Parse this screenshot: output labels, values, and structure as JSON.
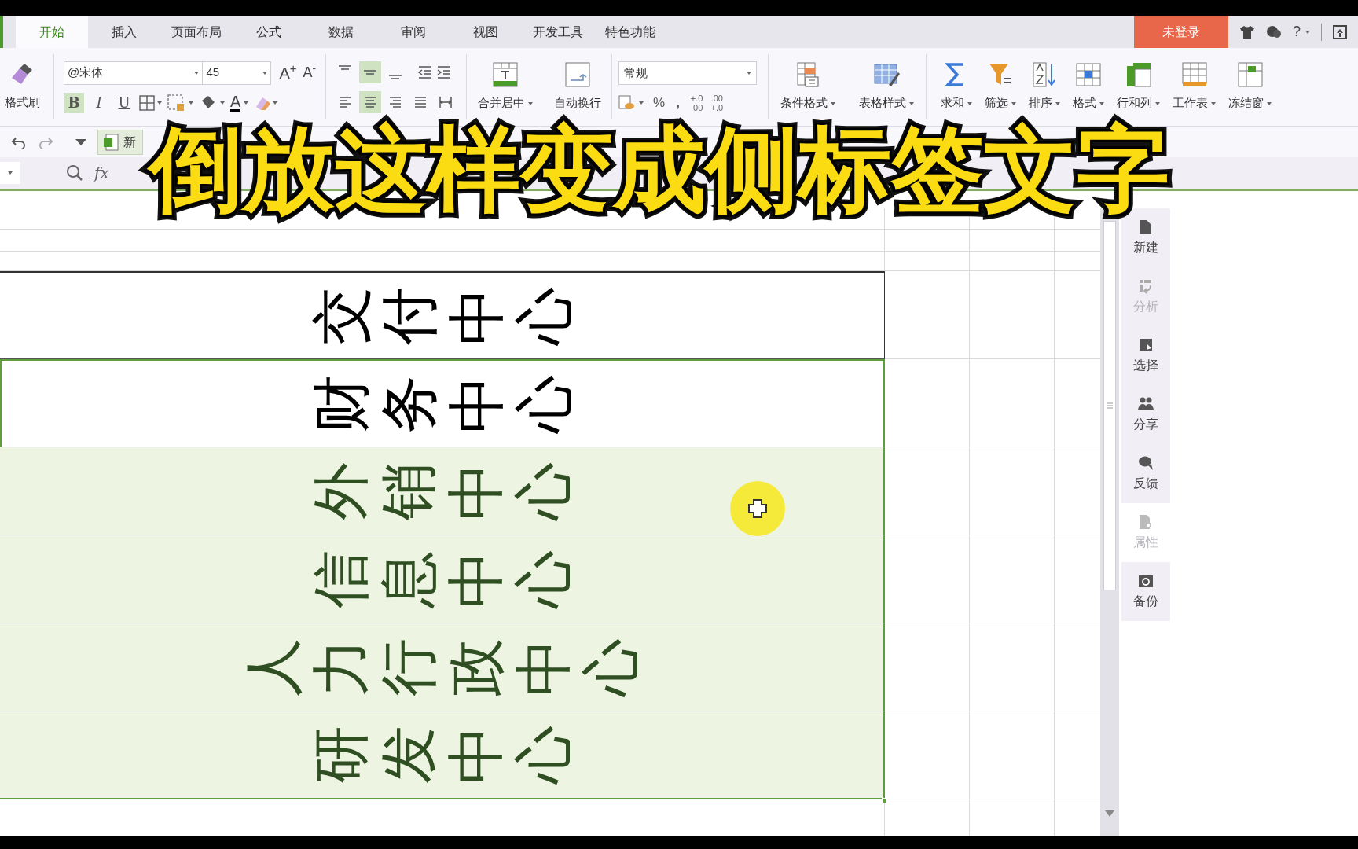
{
  "tabs": [
    {
      "label": "开始",
      "selected": true
    },
    {
      "label": "插入",
      "selected": false
    },
    {
      "label": "页面布局",
      "selected": false
    },
    {
      "label": "公式",
      "selected": false
    },
    {
      "label": "数据",
      "selected": false
    },
    {
      "label": "审阅",
      "selected": false
    },
    {
      "label": "视图",
      "selected": false
    },
    {
      "label": "开发工具",
      "selected": false
    },
    {
      "label": "特色功能",
      "selected": false
    }
  ],
  "account": {
    "login": "未登录",
    "help": "?"
  },
  "ribbon": {
    "format_painter": "格式刷",
    "font_family": "@宋体",
    "font_size": "45",
    "grow_font": "A$^{+}$",
    "shrink_font": "A$^{-}$",
    "styles": [
      {
        "label": "B",
        "on": true
      },
      {
        "label": "I",
        "on": false
      },
      {
        "label": "U",
        "on": false
      }
    ],
    "font_color": "A",
    "vertical_align": [
      {
        "selected": false
      },
      {
        "selected": true
      },
      {
        "selected": false
      }
    ],
    "horizontal_align": [
      {
        "selected": false
      },
      {
        "selected": true
      },
      {
        "selected": false
      },
      {
        "selected": false
      },
      {
        "selected": false
      }
    ],
    "merge": "合并居中",
    "wrap": "自动换行",
    "number_format": "常规",
    "percent": "%",
    "comma": ",",
    "decimals": [
      [
        "+.0",
        ".00"
      ],
      [
        ".00",
        "+.0"
      ]
    ],
    "style_buttons": [
      "条件格式",
      "表格样式"
    ],
    "cell_buttons": [
      "求和",
      "筛选",
      "排序",
      "格式",
      "行和列",
      "工作表",
      "冻结窗"
    ]
  },
  "quick_access": {
    "document_tab": "新"
  },
  "formula_bar": {
    "fx": "fx"
  },
  "sheet": {
    "rows": [
      {
        "text": "交付中心",
        "selected": false,
        "active": false
      },
      {
        "text": "财务中心",
        "selected": true,
        "active": true
      },
      {
        "text": "外销中心",
        "selected": true,
        "active": false
      },
      {
        "text": "信息中心",
        "selected": true,
        "active": false
      },
      {
        "text": "人力行政中心",
        "selected": true,
        "active": false
      },
      {
        "text": "研发中心",
        "selected": true,
        "active": false
      }
    ]
  },
  "side_panel": [
    {
      "label": "新建",
      "disabled": false
    },
    {
      "label": "分析",
      "disabled": true
    },
    {
      "label": "选择",
      "disabled": false
    },
    {
      "label": "分享",
      "disabled": false
    },
    {
      "label": "反馈",
      "disabled": false
    },
    {
      "label": "属性",
      "disabled": true
    },
    {
      "label": "备份",
      "disabled": false
    }
  ],
  "caption": "倒放这样变成侧标签文字"
}
